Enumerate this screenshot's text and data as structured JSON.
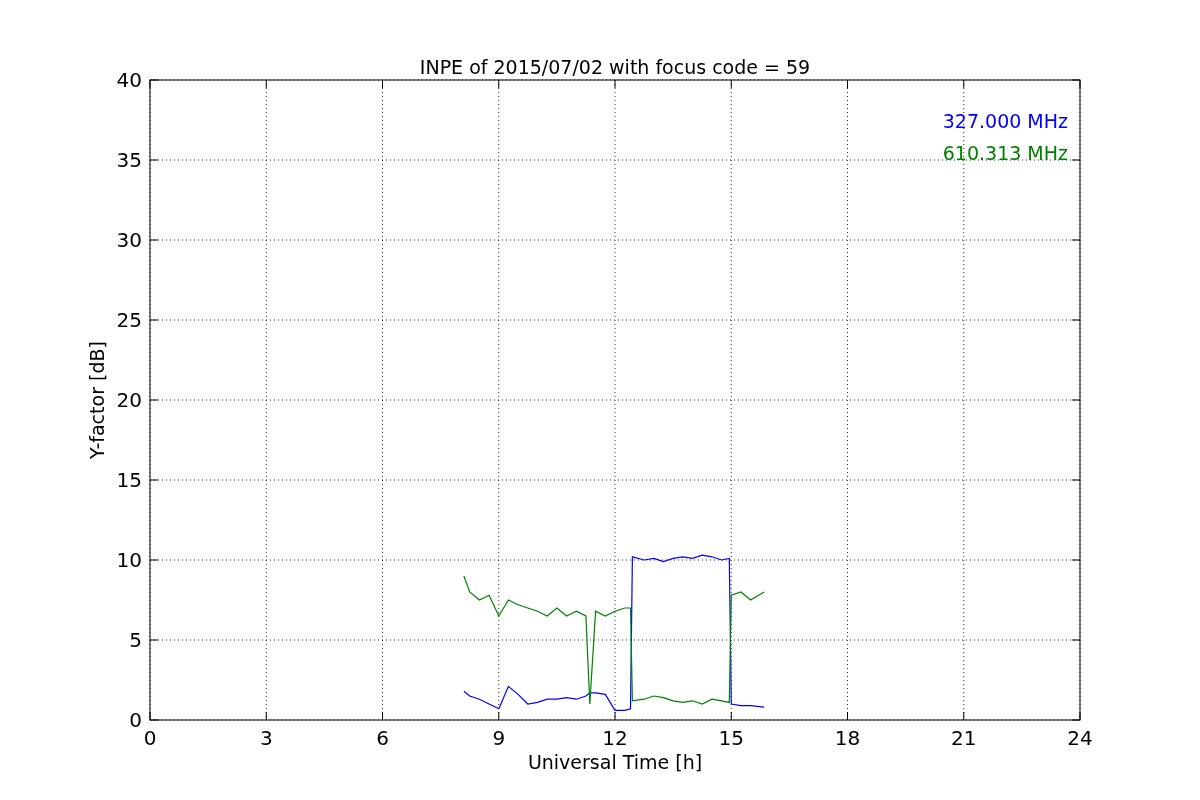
{
  "figure": {
    "chart_data": {
      "type": "line",
      "title": "INPE of 2015/07/02 with focus code = 59",
      "xlabel": "Universal Time [h]",
      "ylabel": "Y-factor [dB]",
      "xlim": [
        0,
        24
      ],
      "ylim": [
        0,
        40
      ],
      "xticks": [
        0,
        3,
        6,
        9,
        12,
        15,
        18,
        21,
        24
      ],
      "yticks": [
        0,
        5,
        10,
        15,
        20,
        25,
        30,
        35,
        40
      ],
      "grid": true,
      "x": [
        8.1,
        8.25,
        8.5,
        8.75,
        9.0,
        9.25,
        9.5,
        9.75,
        10,
        10.25,
        10.5,
        10.75,
        11,
        11.25,
        11.35,
        11.5,
        11.75,
        12,
        12.25,
        12.4,
        12.45,
        12.75,
        13,
        13.25,
        13.5,
        13.75,
        14,
        14.25,
        14.5,
        14.75,
        14.95,
        15.0,
        15.25,
        15.5,
        15.85
      ],
      "series": [
        {
          "name": "327.000 MHz",
          "color": "#0000ff",
          "values": [
            1.8,
            1.5,
            1.3,
            1.0,
            0.7,
            2.1,
            1.6,
            1.0,
            1.1,
            1.3,
            1.3,
            1.4,
            1.3,
            1.5,
            1.7,
            1.7,
            1.6,
            0.6,
            0.6,
            0.7,
            10.2,
            10.0,
            10.1,
            9.9,
            10.1,
            10.2,
            10.1,
            10.3,
            10.2,
            10.0,
            10.1,
            1.0,
            0.9,
            0.9,
            0.8
          ]
        },
        {
          "name": "610.313 MHz",
          "color": "#008000",
          "values": [
            9.0,
            8.0,
            7.5,
            7.8,
            6.5,
            7.5,
            7.2,
            7.0,
            6.8,
            6.5,
            7.0,
            6.5,
            6.8,
            6.5,
            1.0,
            6.8,
            6.5,
            6.8,
            7.0,
            7.0,
            1.2,
            1.3,
            1.5,
            1.4,
            1.2,
            1.1,
            1.2,
            1.0,
            1.3,
            1.2,
            1.1,
            7.8,
            8.0,
            7.5,
            8.0
          ]
        }
      ]
    }
  }
}
